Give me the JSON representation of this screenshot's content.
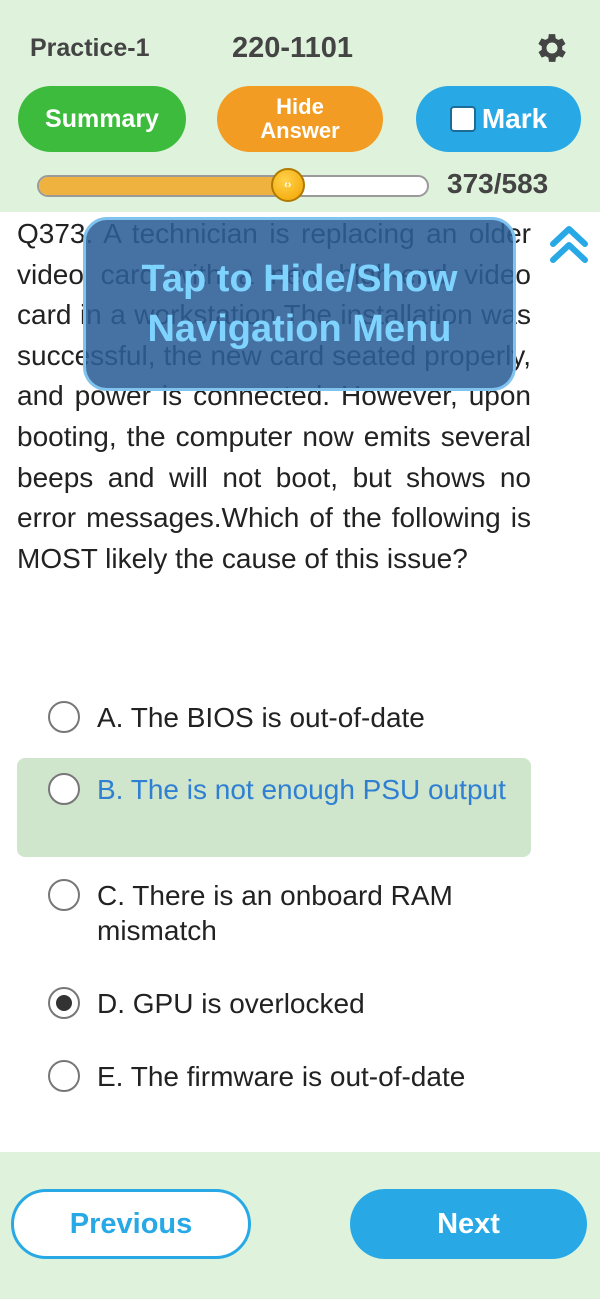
{
  "header": {
    "practice_label": "Practice-1",
    "exam_code": "220-1101",
    "summary_label": "Summary",
    "hide_answer_label": "Hide Answer",
    "mark_label": "Mark",
    "progress_text": "373/583",
    "progress_current": 373,
    "progress_total": 583
  },
  "overlay": {
    "text": "Tap to Hide/Show Navigation Menu"
  },
  "question": {
    "text": "Q373. A technician is replacing an older video card with a new high-end video card in a workstation.The installation was successful, the new card seated properly, and power is connected. However, upon booting, the computer now emits several beeps and will not boot, but shows no error messages.Which of the following is MOST likely the cause of this issue?"
  },
  "options": [
    {
      "label": "A. The BIOS is out-of-date",
      "selected": false,
      "correct": false
    },
    {
      "label": "B. The is not enough PSU output",
      "selected": false,
      "correct": true
    },
    {
      "label": "C. There is an onboard RAM mismatch",
      "selected": false,
      "correct": false
    },
    {
      "label": "D. GPU is overlocked",
      "selected": true,
      "correct": false
    },
    {
      "label": "E. The firmware is out-of-date",
      "selected": false,
      "correct": false
    }
  ],
  "footer": {
    "previous_label": "Previous",
    "next_label": "Next"
  },
  "colors": {
    "header_bg": "#dff3dc",
    "summary_green": "#3dbb3d",
    "hide_orange": "#f29c24",
    "accent_blue": "#28a9e6",
    "correct_bg": "#cfe5cc",
    "correct_text": "#2f7fd2"
  }
}
